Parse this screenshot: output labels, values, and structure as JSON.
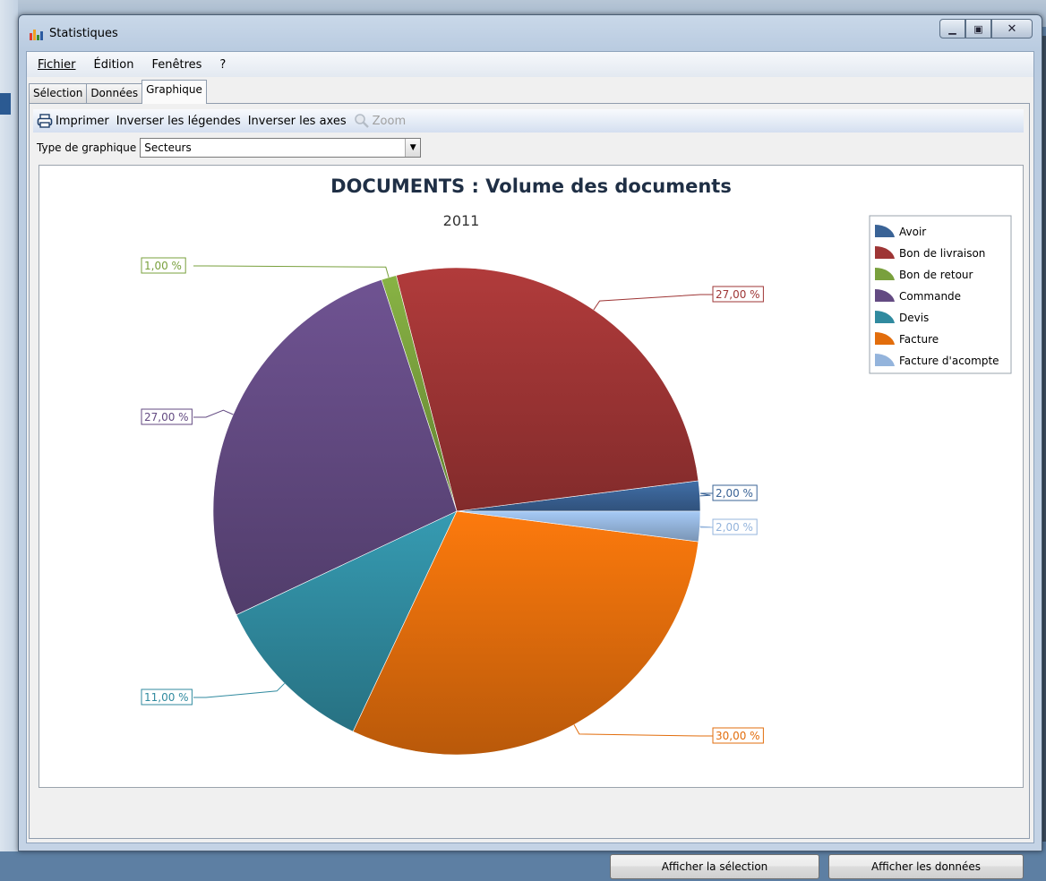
{
  "window": {
    "title": "Statistiques"
  },
  "menu": [
    "Fichier",
    "Édition",
    "Fenêtres",
    "?"
  ],
  "tabs": [
    "Sélection",
    "Données",
    "Graphique"
  ],
  "toolbar": {
    "print": "Imprimer",
    "invert_legends": "Inverser les légendes",
    "invert_axes": "Inverser les axes",
    "zoom": "Zoom"
  },
  "chart_type": {
    "label": "Type de graphique",
    "value": "Secteurs"
  },
  "buttons": {
    "show_selection": "Afficher la sélection",
    "show_data": "Afficher les données"
  },
  "chart_data": {
    "type": "pie",
    "title": "DOCUMENTS : Volume des documents",
    "subtitle": "2011",
    "legend_position": "top-right",
    "slices": [
      {
        "name": "Avoir",
        "value": 2,
        "label": "2,00 %",
        "color": "#3a6396"
      },
      {
        "name": "Bon de livraison",
        "value": 27,
        "label": "27,00 %",
        "color": "#9e3535"
      },
      {
        "name": "Bon de retour",
        "value": 1,
        "label": "1,00 %",
        "color": "#79a03d"
      },
      {
        "name": "Commande",
        "value": 27,
        "label": "27,00 %",
        "color": "#634a82"
      },
      {
        "name": "Devis",
        "value": 11,
        "label": "11,00 %",
        "color": "#308a9f"
      },
      {
        "name": "Facture",
        "value": 30,
        "label": "30,00 %",
        "color": "#e26d0c"
      },
      {
        "name": "Facture d'acompte",
        "value": 2,
        "label": "2,00 %",
        "color": "#94b4dc"
      }
    ]
  }
}
